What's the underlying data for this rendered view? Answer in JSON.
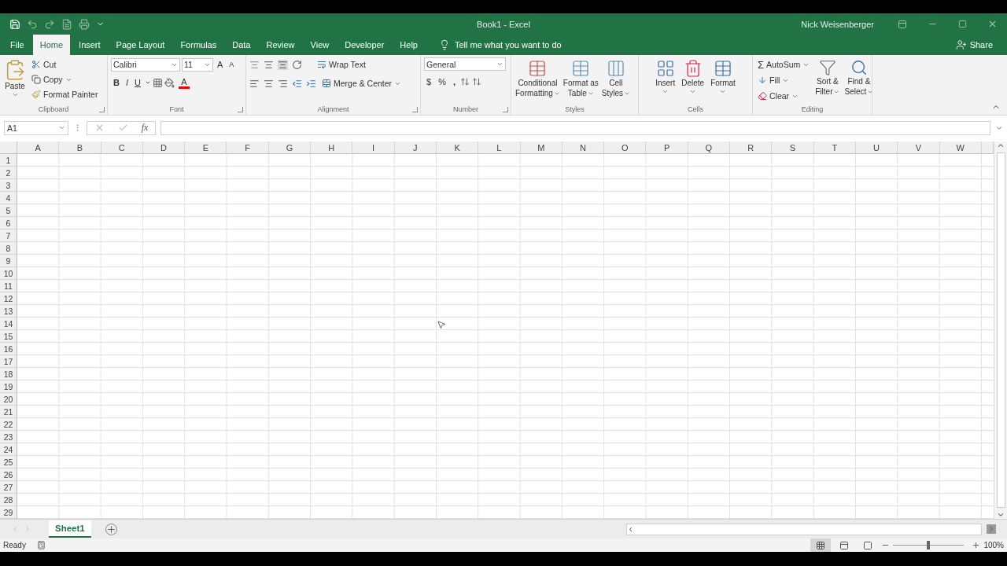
{
  "title_bar": {
    "title": "Book1 - Excel",
    "user": "Nick Weisenberger"
  },
  "tabs": [
    {
      "label": "File",
      "selected": false
    },
    {
      "label": "Home",
      "selected": true
    },
    {
      "label": "Insert",
      "selected": false
    },
    {
      "label": "Page Layout",
      "selected": false
    },
    {
      "label": "Formulas",
      "selected": false
    },
    {
      "label": "Data",
      "selected": false
    },
    {
      "label": "Review",
      "selected": false
    },
    {
      "label": "View",
      "selected": false
    },
    {
      "label": "Developer",
      "selected": false
    },
    {
      "label": "Help",
      "selected": false
    }
  ],
  "tell_me": "Tell me what you want to do",
  "share": "Share",
  "ribbon": {
    "clipboard": {
      "label": "Clipboard",
      "paste": "Paste",
      "cut": "Cut",
      "copy": "Copy",
      "format_painter": "Format Painter"
    },
    "font": {
      "label": "Font",
      "font_name": "Calibri",
      "font_size": "11",
      "grow": "A",
      "shrink": "A",
      "bold": "B",
      "italic": "I",
      "underline": "U",
      "font_color": "A"
    },
    "alignment": {
      "label": "Alignment",
      "wrap_text": "Wrap Text",
      "merge_center": "Merge & Center"
    },
    "number": {
      "label": "Number",
      "format": "General",
      "currency": "$",
      "percent": "%",
      "comma": ","
    },
    "styles": {
      "label": "Styles",
      "buttons": [
        {
          "lines": [
            "Conditional",
            "Formatting"
          ]
        },
        {
          "lines": [
            "Format as",
            "Table"
          ]
        },
        {
          "lines": [
            "Cell",
            "Styles"
          ]
        }
      ]
    },
    "cells": {
      "label": "Cells",
      "buttons": [
        "Insert",
        "Delete",
        "Format"
      ]
    },
    "editing": {
      "label": "Editing",
      "autosum_sign": "Σ",
      "autosum": "AutoSum",
      "fill": "Fill",
      "clear": "Clear",
      "sort": [
        "Sort &",
        "Filter"
      ],
      "find": [
        "Find &",
        "Select"
      ]
    }
  },
  "formula_bar": {
    "name_box": "A1",
    "function_label": "fx"
  },
  "columns": [
    "A",
    "B",
    "C",
    "D",
    "E",
    "F",
    "G",
    "H",
    "I",
    "J",
    "K",
    "L",
    "M",
    "N",
    "O",
    "P",
    "Q",
    "R",
    "S",
    "T",
    "U",
    "V",
    "W"
  ],
  "rows": [
    "1",
    "2",
    "3",
    "4",
    "5",
    "6",
    "7",
    "8",
    "9",
    "10",
    "11",
    "12",
    "13",
    "14",
    "15",
    "16",
    "17",
    "18",
    "19",
    "20",
    "21",
    "22",
    "23",
    "24",
    "25",
    "26",
    "27",
    "28",
    "29"
  ],
  "sheets": [
    {
      "label": "Sheet1",
      "selected": true
    }
  ],
  "status_bar": {
    "status": "Ready",
    "zoom": "100%",
    "zoom_slider": {
      "level": 0.5
    }
  }
}
